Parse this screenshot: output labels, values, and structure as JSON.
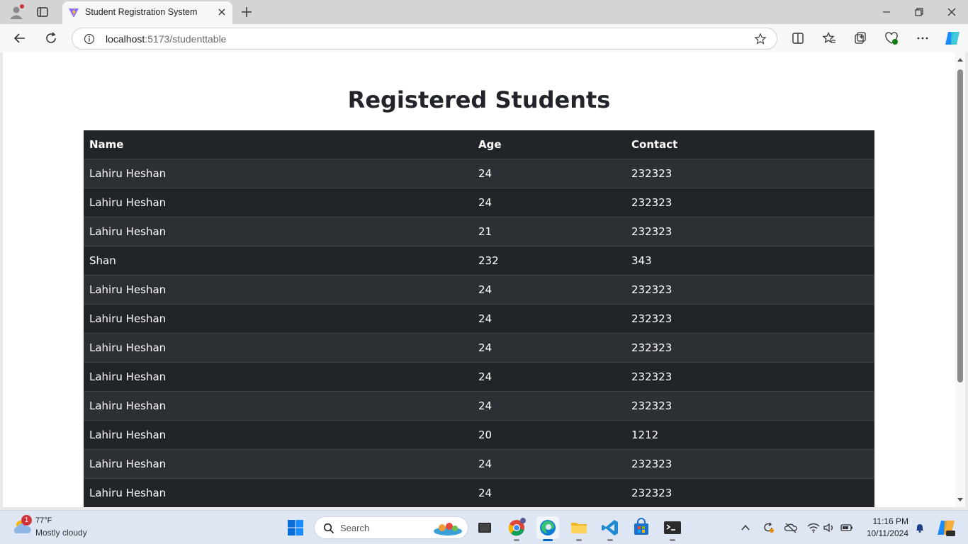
{
  "browser": {
    "tab_title": "Student Registration System",
    "url_host": "localhost",
    "url_path": ":5173/studenttable"
  },
  "page": {
    "title": "Registered Students",
    "table": {
      "headers": [
        "Name",
        "Age",
        "Contact"
      ],
      "rows": [
        [
          "Lahiru Heshan",
          "24",
          "232323"
        ],
        [
          "Lahiru Heshan",
          "24",
          "232323"
        ],
        [
          "Lahiru Heshan",
          "21",
          "232323"
        ],
        [
          "Shan",
          "232",
          "343"
        ],
        [
          "Lahiru Heshan",
          "24",
          "232323"
        ],
        [
          "Lahiru Heshan",
          "24",
          "232323"
        ],
        [
          "Lahiru Heshan",
          "24",
          "232323"
        ],
        [
          "Lahiru Heshan",
          "24",
          "232323"
        ],
        [
          "Lahiru Heshan",
          "24",
          "232323"
        ],
        [
          "Lahiru Heshan",
          "20",
          "1212"
        ],
        [
          "Lahiru Heshan",
          "24",
          "232323"
        ],
        [
          "Lahiru Heshan",
          "24",
          "232323"
        ]
      ]
    }
  },
  "taskbar": {
    "weather_badge": "1",
    "weather_temp": "77°F",
    "weather_desc": "Mostly cloudy",
    "search_label": "Search",
    "time": "11:16 PM",
    "date": "10/11/2024"
  },
  "colors": {
    "table_dark": "#212529",
    "table_striped": "#2c3034",
    "accent": "#0067c0"
  }
}
